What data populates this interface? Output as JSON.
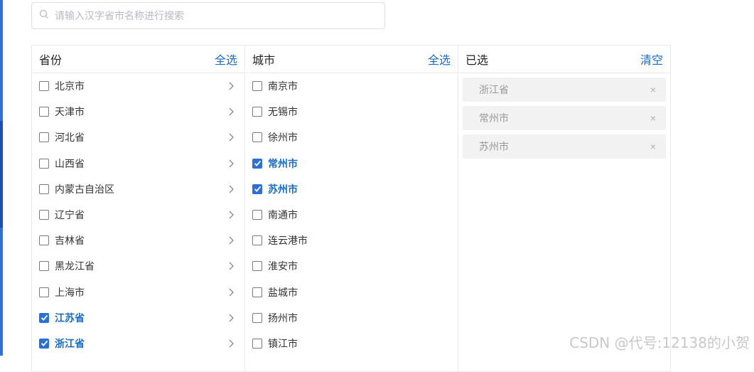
{
  "search": {
    "placeholder": "请输入汉字省市名称进行搜索"
  },
  "colors": {
    "accent": "#1a6cc4",
    "checked": "#2d6fd8",
    "tag_bg": "#f2f2f2"
  },
  "provinces": {
    "title": "省份",
    "select_all": "全选",
    "items": [
      {
        "label": "北京市",
        "checked": false
      },
      {
        "label": "天津市",
        "checked": false
      },
      {
        "label": "河北省",
        "checked": false
      },
      {
        "label": "山西省",
        "checked": false
      },
      {
        "label": "内蒙古自治区",
        "checked": false
      },
      {
        "label": "辽宁省",
        "checked": false
      },
      {
        "label": "吉林省",
        "checked": false
      },
      {
        "label": "黑龙江省",
        "checked": false
      },
      {
        "label": "上海市",
        "checked": false
      },
      {
        "label": "江苏省",
        "checked": true
      },
      {
        "label": "浙江省",
        "checked": true
      }
    ]
  },
  "cities": {
    "title": "城市",
    "select_all": "全选",
    "items": [
      {
        "label": "南京市",
        "checked": false
      },
      {
        "label": "无锡市",
        "checked": false
      },
      {
        "label": "徐州市",
        "checked": false
      },
      {
        "label": "常州市",
        "checked": true
      },
      {
        "label": "苏州市",
        "checked": true
      },
      {
        "label": "南通市",
        "checked": false
      },
      {
        "label": "连云港市",
        "checked": false
      },
      {
        "label": "淮安市",
        "checked": false
      },
      {
        "label": "盐城市",
        "checked": false
      },
      {
        "label": "扬州市",
        "checked": false
      },
      {
        "label": "镇江市",
        "checked": false
      }
    ]
  },
  "selected": {
    "title": "已选",
    "clear": "清空",
    "items": [
      {
        "label": "浙江省",
        "close": "×"
      },
      {
        "label": "常州市",
        "close": "×"
      },
      {
        "label": "苏州市",
        "close": "×"
      }
    ]
  },
  "watermark": "CSDN @代号:12138的小贺"
}
